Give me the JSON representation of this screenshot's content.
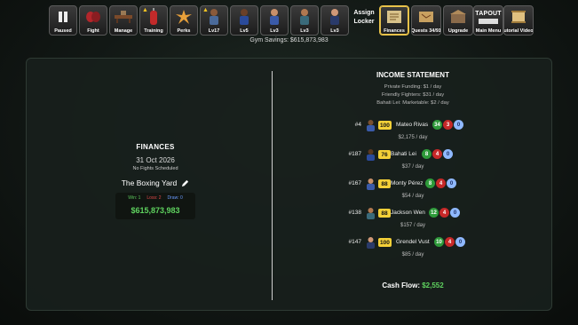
{
  "toolbar": {
    "items": [
      {
        "label": "Paused",
        "icon": "pause-icon"
      },
      {
        "label": "Fight",
        "icon": "gloves-icon"
      },
      {
        "label": "Manage",
        "icon": "desk-icon"
      },
      {
        "label": "Training",
        "icon": "punching-bag-icon"
      },
      {
        "label": "Perks",
        "icon": "burst-icon"
      },
      {
        "label": "Lv17",
        "icon": "fighter-portrait-icon"
      },
      {
        "label": "Lv5",
        "icon": "fighter-portrait-icon"
      },
      {
        "label": "Lv3",
        "icon": "fighter-portrait-icon"
      },
      {
        "label": "Lv3",
        "icon": "fighter-portrait-icon"
      },
      {
        "label": "Lv3",
        "icon": "fighter-portrait-icon"
      },
      {
        "label": "Finances",
        "icon": "ledger-icon"
      },
      {
        "label": "Quests 34/91",
        "icon": "scroll-map-icon"
      },
      {
        "label": "Upgrade",
        "icon": "gym-upgrade-icon"
      },
      {
        "label": "Main Menu",
        "icon": "tapout-logo-icon"
      },
      {
        "label": "Tutorial Videos",
        "icon": "scroll-icon"
      }
    ],
    "assign_line1": "Assign",
    "assign_line2": "Locker",
    "tapout_logo_text": "TAPOUT"
  },
  "gym_savings": "Gym Savings: $615,873,983",
  "finances": {
    "title": "FINANCES",
    "date": "31 Oct 2026",
    "fights_status": "No Fights Scheduled",
    "gym_name": "The Boxing Yard",
    "win": "Win: 1",
    "loss": "Loss: 2",
    "draw": "Draw: 0",
    "money": "$615,873,983"
  },
  "income": {
    "title": "INCOME STATEMENT",
    "private_funding": "Private Funding: $1 / day",
    "friendly_fighters": "Friendly Fighters: $31 / day",
    "marketable": "Bahati Lei: Marketable: $2 / day",
    "fighters": [
      {
        "rank": "#4",
        "ovr": "100",
        "name": "Mateo Rivas",
        "w": "34",
        "l": "3",
        "d": "0",
        "pay": "$2,175 / day"
      },
      {
        "rank": "#187",
        "ovr": "76",
        "name": "Bahati Lei",
        "w": "8",
        "l": "4",
        "d": "0",
        "pay": "$37 / day"
      },
      {
        "rank": "#167",
        "ovr": "88",
        "name": "Monty Pérez",
        "w": "8",
        "l": "4",
        "d": "0",
        "pay": "$54 / day"
      },
      {
        "rank": "#138",
        "ovr": "88",
        "name": "Jackson Wen",
        "w": "12",
        "l": "4",
        "d": "0",
        "pay": "$157 / day"
      },
      {
        "rank": "#147",
        "ovr": "100",
        "name": "Grendel Vust",
        "w": "10",
        "l": "4",
        "d": "0",
        "pay": "$85 / day"
      }
    ],
    "cash_flow_label": "Cash Flow:",
    "cash_flow_value": "$2,552"
  },
  "colors": {
    "accent_gold": "#f4d038",
    "money_green": "#5fd35f",
    "win_green": "#2e9a3a",
    "loss_red": "#c62828",
    "draw_blue": "#8fb8ff"
  }
}
